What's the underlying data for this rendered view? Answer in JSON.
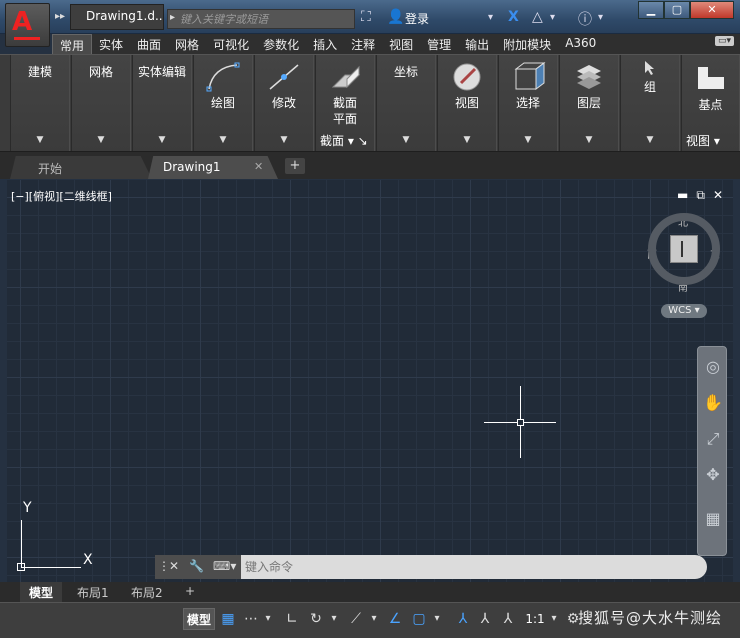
{
  "titlebar": {
    "doc_title": "Drawing1.d...",
    "search_placeholder": "键入关键字或短语",
    "login_label": "登录"
  },
  "ribbon_tabs": [
    "常用",
    "实体",
    "曲面",
    "网格",
    "可视化",
    "参数化",
    "插入",
    "注释",
    "视图",
    "管理",
    "输出",
    "附加模块",
    "A360"
  ],
  "active_ribbon_tab": "常用",
  "panels": {
    "modeling": "建模",
    "mesh": "网格",
    "solid_edit": "实体编辑",
    "draw": "绘图",
    "modify": "修改",
    "section": "截面",
    "section_plane": "截面\n平面",
    "coordinates": "坐标",
    "view": "视图",
    "selection": "选择",
    "layers": "图层",
    "groups": "组",
    "base_point": "基点",
    "view_footer": "视图"
  },
  "file_tabs": {
    "start": "开始",
    "drawing": "Drawing1",
    "close": "✕",
    "plus": "+"
  },
  "viewport": {
    "label": "[−][俯视][二维线框]",
    "compass": {
      "north": "北",
      "south": "南",
      "west": "西",
      "east": "东"
    },
    "wcs": "WCS ▾",
    "ucs_x": "X",
    "ucs_y": "Y"
  },
  "command": {
    "placeholder": "键入命令"
  },
  "layout_tabs": [
    "模型",
    "布局1",
    "布局2"
  ],
  "statusbar": {
    "model": "模型",
    "scale": "1:1"
  },
  "watermark": "搜狐号@大水牛测绘",
  "colors": {
    "canvas_bg": "#212b38",
    "accent_blue": "#4aa3ff",
    "logo_red": "#e22222"
  }
}
